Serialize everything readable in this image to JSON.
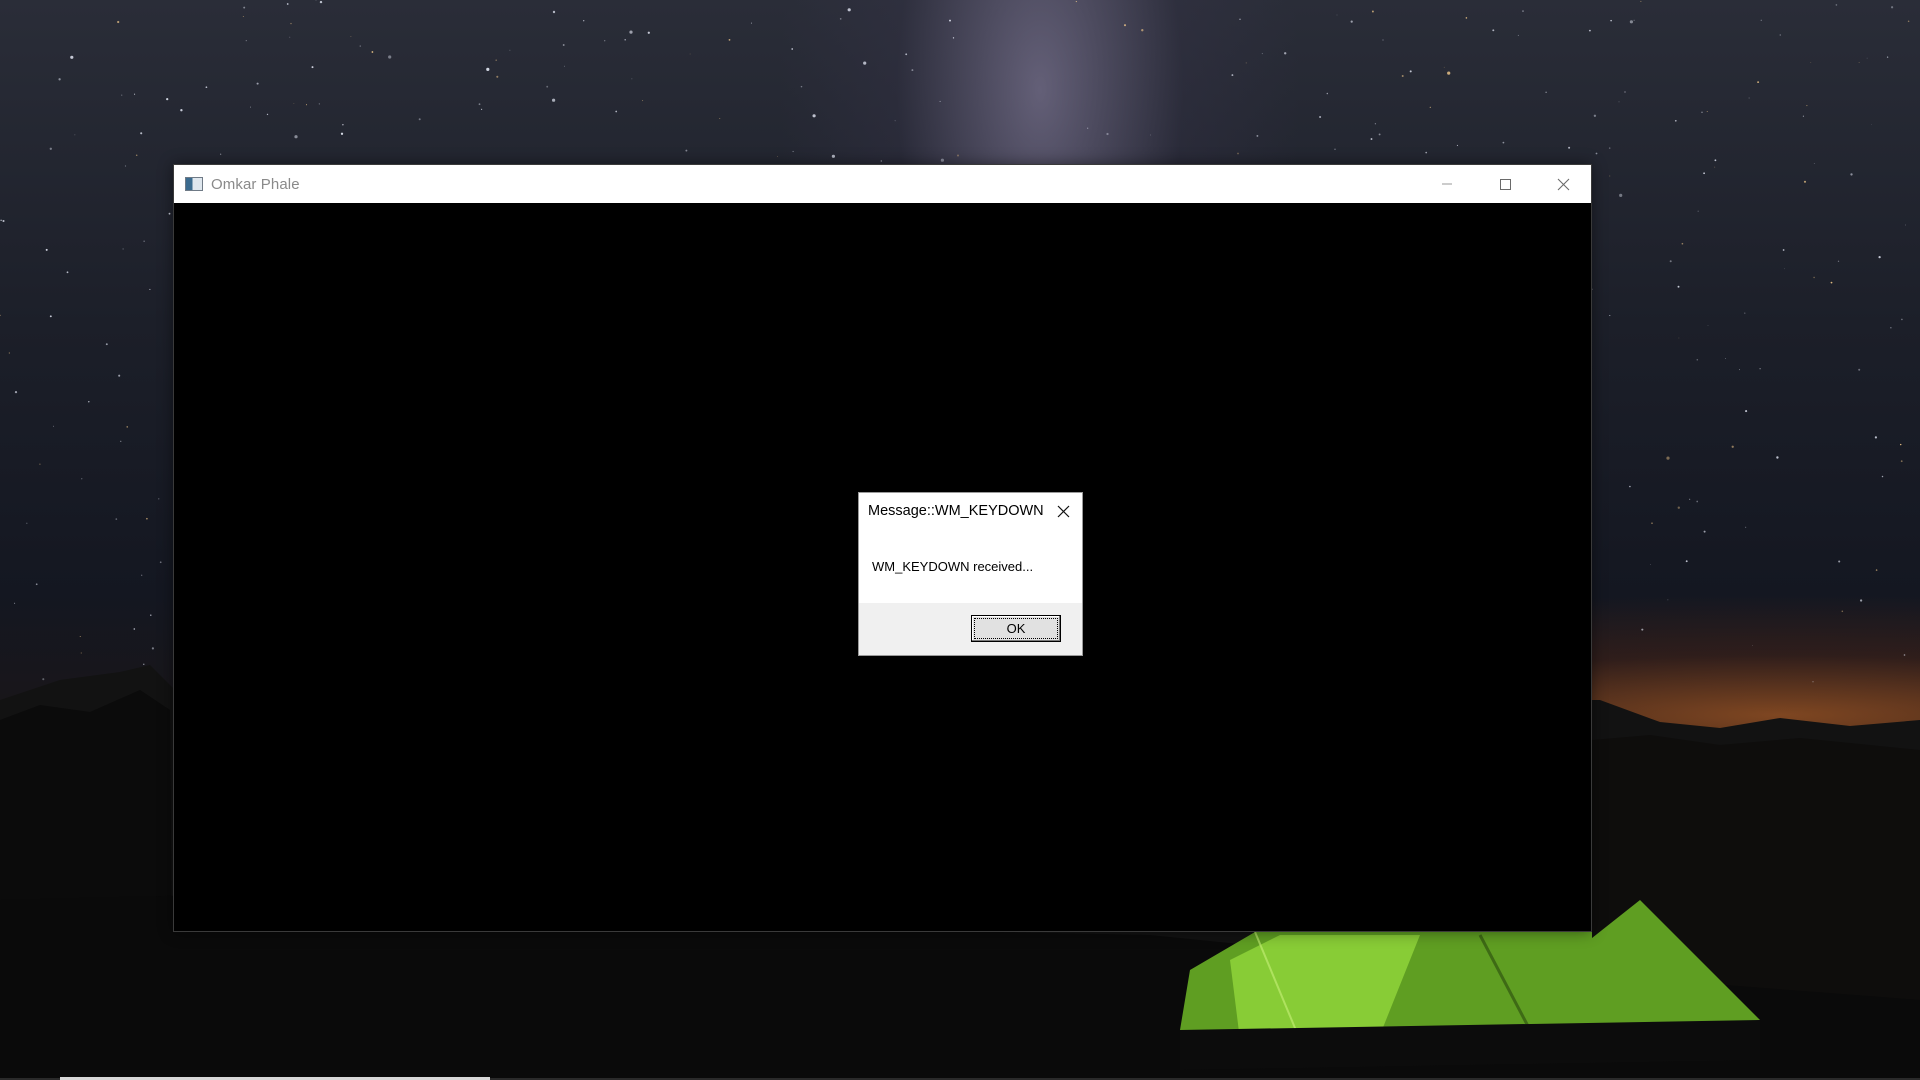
{
  "window": {
    "title": "Omkar Phale",
    "controls": {
      "minimize_icon": "minimize-icon",
      "maximize_icon": "maximize-icon",
      "close_icon": "close-icon"
    },
    "client_background": "#000000"
  },
  "message_box": {
    "title": "Message::WM_KEYDOWN",
    "message": "WM_KEYDOWN received...",
    "ok_label": "OK",
    "close_icon": "close-icon"
  },
  "wallpaper": {
    "description_icon": "starry-night-tent-wallpaper"
  }
}
